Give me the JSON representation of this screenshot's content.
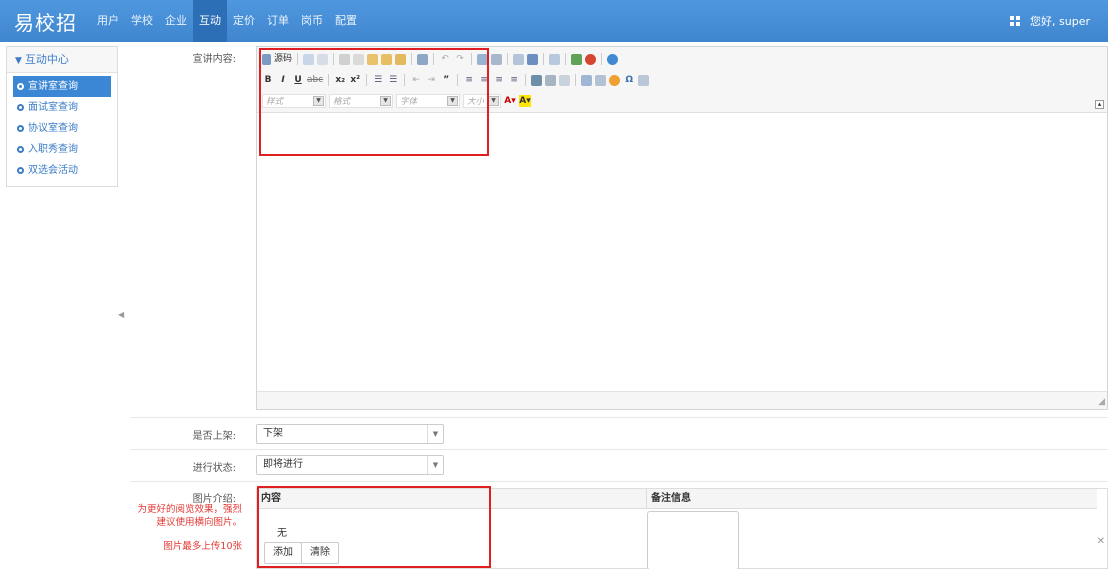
{
  "brand": "易校招",
  "nav": [
    "用户",
    "学校",
    "企业",
    "互动",
    "定价",
    "订单",
    "岗币",
    "配置"
  ],
  "nav_active_index": 3,
  "user_greeting": "您好, super",
  "sidebar": {
    "title": "互动中心",
    "items": [
      "宣讲室查询",
      "面试室查询",
      "协议室查询",
      "入职秀查询",
      "双选会活动"
    ],
    "active_index": 0
  },
  "form": {
    "content_label": "宣讲内容:",
    "onshelf_label": "是否上架:",
    "onshelf_value": "下架",
    "status_label": "进行状态:",
    "status_value": "即将进行",
    "image_label": "图片介绍:",
    "image_note": "为更好的阅览效果，强烈建议使用横向图片。",
    "image_limit": "图片最多上传10张"
  },
  "editor": {
    "source_label": "源码",
    "format_combos": [
      "样式",
      "格式",
      "字体",
      "大小"
    ]
  },
  "image_table": {
    "col_content": "内容",
    "col_note": "备注信息",
    "empty_text": "无",
    "add_label": "添加",
    "clear_label": "清除"
  },
  "colors": {
    "navbar": "#4a90d9",
    "accent": "#3b87d6",
    "highlight": "#e02020",
    "note_red": "#e53935"
  }
}
